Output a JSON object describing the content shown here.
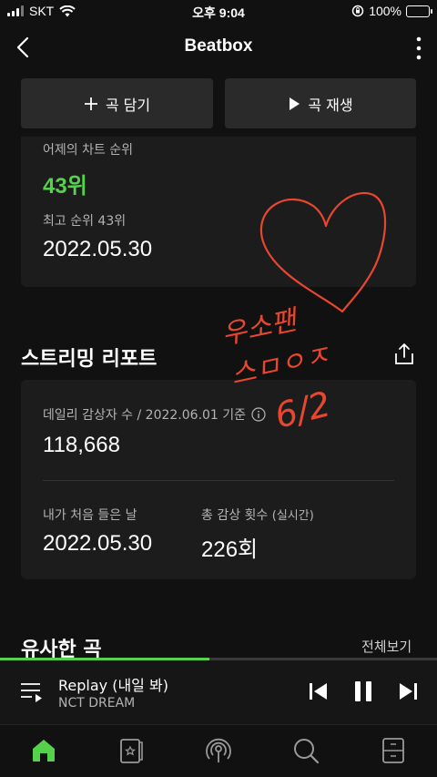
{
  "status_bar": {
    "carrier": "SKT",
    "time": "오후 9:04",
    "battery": "100%"
  },
  "header": {
    "title": "Beatbox"
  },
  "actions": {
    "add_label": "곡 담기",
    "play_label": "곡 재생"
  },
  "chart_card": {
    "yesterday_label": "어제의 차트 순위",
    "yesterday_value": "43위",
    "best_label": "최고 순위 43위",
    "best_date": "2022.05.30"
  },
  "report": {
    "title": "스트리밍 리포트",
    "daily_label": "데일리 감상자 수 / 2022.06.01 기준",
    "daily_value": "118,668",
    "first_heard_label": "내가 처음 들은 날",
    "first_heard_value": "2022.05.30",
    "total_label": "총 감상 횟수",
    "total_label_suffix": "(실시간)",
    "total_value": "226회"
  },
  "similar": {
    "title": "유사한 곡",
    "see_all": "전체보기"
  },
  "now_playing": {
    "title": "Replay (내일 봐)",
    "artist": "NCT DREAM",
    "progress": 0.48
  },
  "annotation": {
    "line1": "우소팬",
    "line2": "스ㅁㅇㅈ",
    "line3": "6/2"
  },
  "colors": {
    "accent": "#55d14b",
    "background": "#111111",
    "card": "#1c1c1c",
    "annotation": "#e8472f"
  },
  "tabs": [
    "home-icon",
    "library-icon",
    "podcast-icon",
    "search-icon",
    "storage-icon"
  ]
}
